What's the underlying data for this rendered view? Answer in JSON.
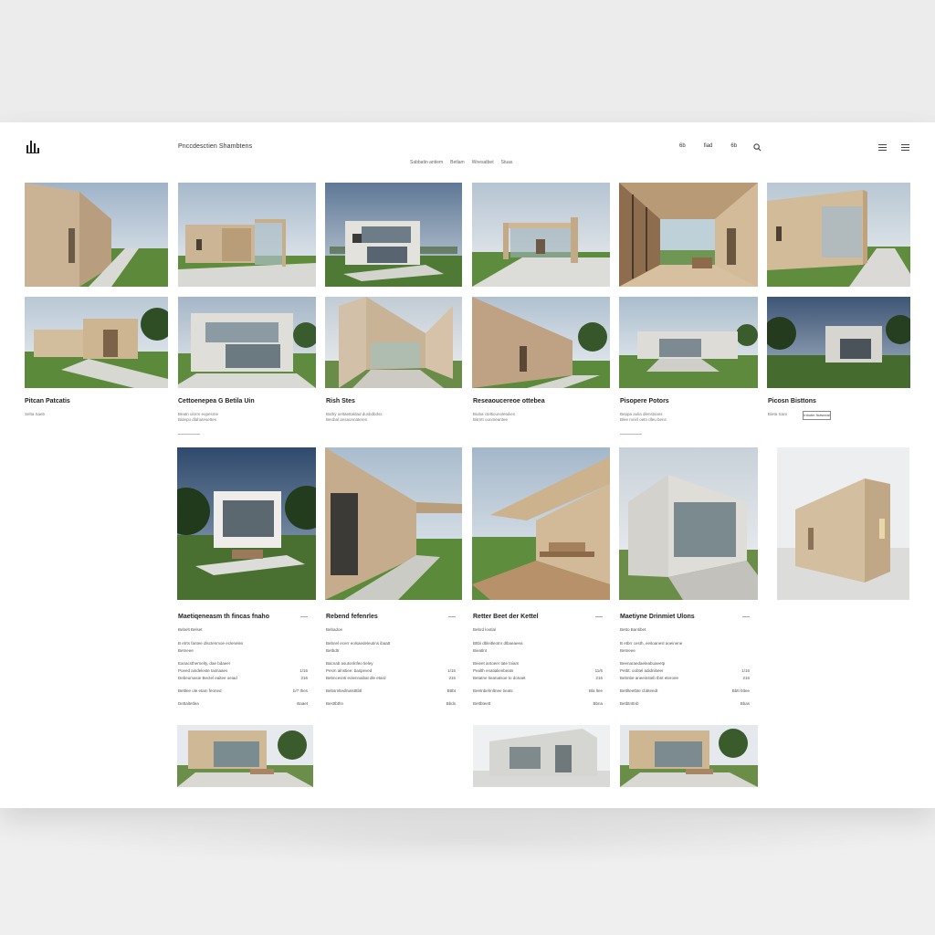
{
  "header": {
    "brand": "Pnccdesctien Shambtens",
    "subnav": [
      "Sabbatin antiem",
      "Betlam",
      "Wnesatbet",
      "Stuas"
    ],
    "nav": [
      "6b",
      "fiad",
      "6b"
    ],
    "accent": "#222222"
  },
  "row2_captions": [
    {
      "title": "Pitcan Patcatis",
      "sub": [
        "Selta Saeb"
      ]
    },
    {
      "title": "Cettoenepea G Betila Uin",
      "sub": [
        "Beatn ulorm eopesme",
        "Bidepo dlahutesettes"
      ]
    },
    {
      "title": "Rish Stes",
      "sub": [
        "Bathy oeltaettaldad dusbdbdss",
        "Beobal ansaonnateres"
      ]
    },
    {
      "title": "Reseaoucereoe ottebea",
      "sub": [
        "Bioba cteltiounoletulies",
        "Bitrntt oonmeantee"
      ]
    },
    {
      "title": "Pisopere Potors",
      "sub": [
        "Beppa aolia dlenstsans",
        "Blee mnirl oetn dleu bens"
      ]
    },
    {
      "title": "Picosn Bisttons",
      "sub": [
        "Bieta Sare"
      ],
      "button": "Inbotm fiorsneal"
    }
  ],
  "details": [
    {
      "title": "Maetiqeneasm th fincas fnaho",
      "meta": "Bebelt Belset",
      "intro": [
        "B etrts fantee dlsctenmoe ecleneles",
        "Betneee"
      ],
      "rows": [
        [
          "Eanacsthernelty, dae bdaeer",
          ""
        ],
        [
          "Poeed aindeleste taimaaes",
          "1/16"
        ],
        [
          "Debeumasie Bectel eaitee oeiad",
          "216"
        ]
      ],
      "rows2": [
        [
          "Bettlee ole etam feoned",
          "b/7 thes"
        ],
        [
          "Dettaltetlea",
          "Baaet"
        ]
      ]
    },
    {
      "title": "Rebend fefenrles",
      "meta": "Bebadoe",
      "intro": [
        "Bebnel ecerr eolsaedeleutins ibaatt",
        "Betbdtr"
      ],
      "rows": [
        [
          "Bacnab asutonlnfeo tieley",
          ""
        ],
        [
          "Pesm alnstiee: baspeved",
          "1/16"
        ],
        [
          "Bebncesnti eolennaibat dle etard",
          "216"
        ]
      ],
      "rows2": [
        [
          "Bebsrnltedlnalstttbtl",
          "Bttbt"
        ],
        [
          "Besttbthn",
          "Bbds"
        ]
      ]
    },
    {
      "title": "Retter Beet der Kettel",
      "meta": "Bebrd lootlal",
      "intro": [
        "Bttbi dbleitleotnr dlbaeaeea",
        "Bieatlnt"
      ],
      "rows": [
        [
          "Beieet antoeer tate tniam",
          ""
        ],
        [
          "Pealth enatialienbeats",
          "11/6"
        ],
        [
          "Betatne tieanatsoe to donaet",
          "216"
        ]
      ],
      "rows2": [
        [
          "Beetnbehnltnee tieats",
          "Bla ltee"
        ],
        [
          "Bettbteett",
          "Bbna"
        ]
      ]
    },
    {
      "title": "Maetiyne Drinmiet Ulons",
      "meta": "Betto Bantibet",
      "intro": [
        "B etbrr cesth, eeitoanesl aoeinene",
        "Betneee"
      ],
      "rows": [
        [
          "Beenaraedaeleabuaeetp",
          ""
        ],
        [
          "Petbt: oobtel adidnibeer",
          "1/16"
        ],
        [
          "Bebnbe aneeinsteb tbnt eteroee",
          "216"
        ]
      ],
      "rows2": [
        [
          "Bettlteetbte cbbteedt",
          "Bbtt bttee"
        ],
        [
          "Betbtnttnb",
          "Bbas"
        ]
      ]
    }
  ],
  "icons": {
    "search": "search-icon",
    "menu": "menu-icon",
    "logo": "bar-logo-icon"
  }
}
